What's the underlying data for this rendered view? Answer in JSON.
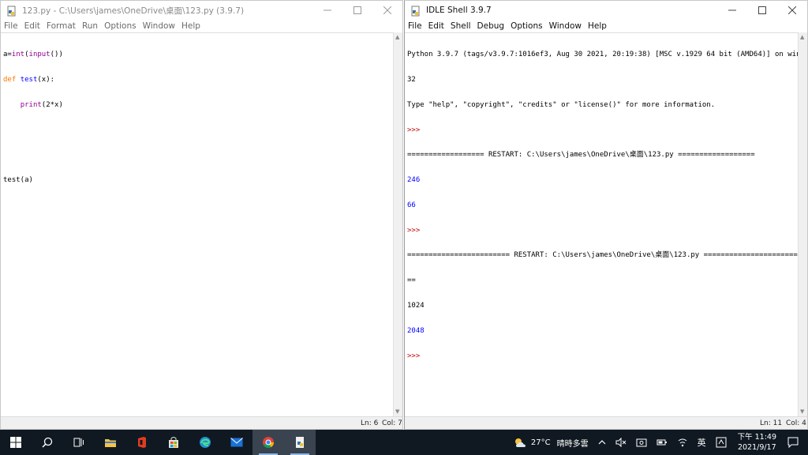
{
  "editor": {
    "title": "123.py - C:\\Users\\james\\OneDrive\\桌面\\123.py (3.9.7)",
    "menu": [
      "File",
      "Edit",
      "Format",
      "Run",
      "Options",
      "Window",
      "Help"
    ],
    "code": {
      "l1": {
        "a": "a=",
        "b": "int",
        "c": "(",
        "d": "input",
        "e": "())"
      },
      "l2": {
        "a": "def",
        "b": " ",
        "c": "test",
        "d": "(x):"
      },
      "l3": {
        "a": "    ",
        "b": "print",
        "c": "(2*x)"
      },
      "l6": "test(a)"
    },
    "status": {
      "ln": "Ln: 6",
      "col": "Col: 7"
    }
  },
  "shell": {
    "title": "IDLE Shell 3.9.7",
    "menu": [
      "File",
      "Edit",
      "Shell",
      "Debug",
      "Options",
      "Window",
      "Help"
    ],
    "lines": {
      "banner1": "Python 3.9.7 (tags/v3.9.7:1016ef3, Aug 30 2021, 20:19:38) [MSC v.1929 64 bit (AMD64)] on win",
      "banner2": "32",
      "banner3": "Type \"help\", \"copyright\", \"credits\" or \"license()\" for more information.",
      "prompt": ">>>",
      "restart1": "================== RESTART: C:\\Users\\james\\OneDrive\\桌面\\123.py ==================",
      "in1": "246",
      "out1": "66",
      "restart2": "======================== RESTART: C:\\Users\\james\\OneDrive\\桌面\\123.py =======================",
      "restart2b": "==",
      "in2": "1024",
      "out2": "2048"
    },
    "status": {
      "ln": "Ln: 11",
      "col": "Col: 4"
    }
  },
  "taskbar": {
    "weather_temp": "27°C",
    "weather_desc": "晴時多雲",
    "ime": "英",
    "time": "下午 11:49",
    "date": "2021/9/17"
  },
  "colors": {
    "keyword": "#ff7700",
    "builtin": "#900090",
    "definition": "#0000ff",
    "stdout": "#0000ff",
    "prompt": "#c00000",
    "taskbar_bg": "#101922"
  }
}
